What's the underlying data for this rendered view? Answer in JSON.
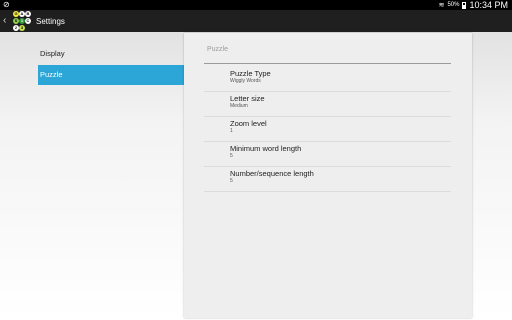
{
  "status": {
    "left_icon": "notification-icon",
    "battery": "50%",
    "time": "10:34 PM"
  },
  "actionbar": {
    "title": "Settings",
    "up_icon": "chevron-left-icon",
    "app_icon": {
      "letters": [
        "A",
        "B",
        "C",
        "1",
        "2",
        "3",
        "G",
        "S"
      ],
      "colors": [
        "#f7ef3c",
        "#8fd14f",
        "#2e9c3b",
        "#c7e34f"
      ]
    }
  },
  "nav": {
    "items": [
      {
        "label": "Display"
      },
      {
        "label": "Puzzle"
      }
    ],
    "active_index": 1
  },
  "panel": {
    "header": "Puzzle",
    "prefs": [
      {
        "title": "Puzzle Type",
        "summary": "Wiggly Words"
      },
      {
        "title": "Letter size",
        "summary": "Medium"
      },
      {
        "title": "Zoom level",
        "summary": "1"
      },
      {
        "title": "Minimum word length",
        "summary": "5"
      },
      {
        "title": "Number/sequence length",
        "summary": "5"
      }
    ]
  },
  "colors": {
    "accent": "#2ba6d6",
    "actionbar": "#1f1f1f",
    "statusbar": "#000000"
  }
}
